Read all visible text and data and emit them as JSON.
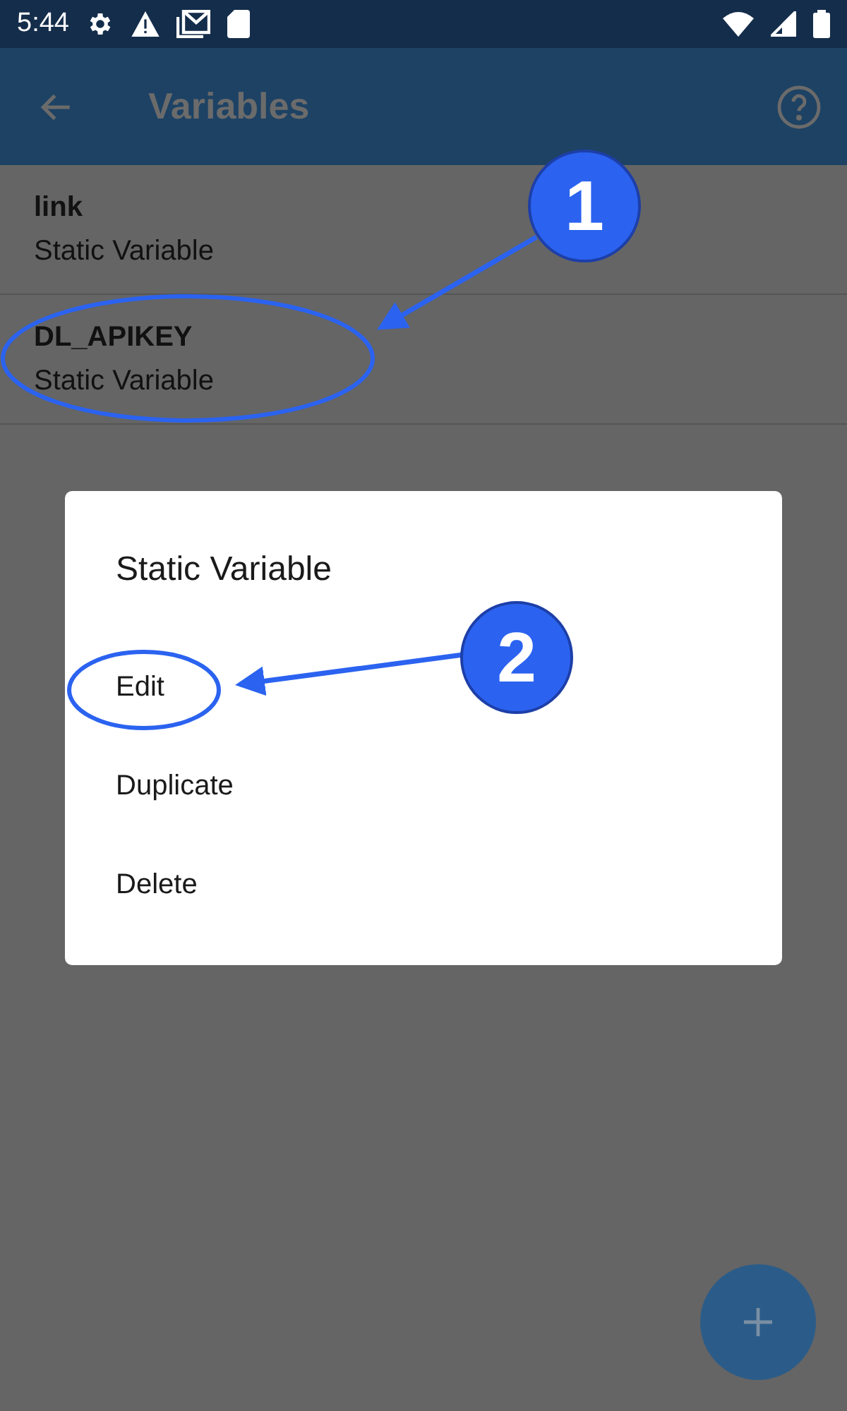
{
  "status_bar": {
    "time": "5:44"
  },
  "app_bar": {
    "title": "Variables"
  },
  "variables": [
    {
      "name": "link",
      "type": "Static Variable"
    },
    {
      "name": "DL_APIKEY",
      "type": "Static Variable"
    }
  ],
  "dialog": {
    "title": "Static Variable",
    "options": [
      "Edit",
      "Duplicate",
      "Delete"
    ]
  },
  "callouts": [
    {
      "label": "1"
    },
    {
      "label": "2"
    }
  ]
}
